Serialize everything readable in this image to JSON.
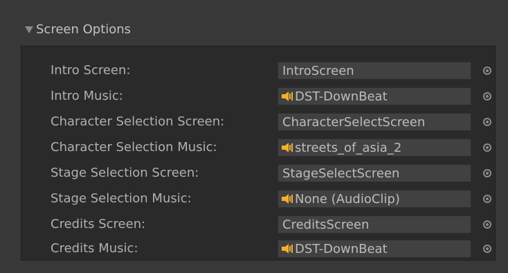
{
  "foldout": {
    "label": "Screen Options",
    "expanded": true
  },
  "rows": [
    {
      "label": "Intro Screen:",
      "value": "IntroScreen",
      "type": "string"
    },
    {
      "label": "Intro Music:",
      "value": "DST-DownBeat",
      "type": "audio",
      "icon": "audio-clip-icon"
    },
    {
      "label": "Character Selection Screen:",
      "value": "CharacterSelectScreen",
      "type": "string"
    },
    {
      "label": "Character Selection Music:",
      "value": "streets_of_asia_2",
      "type": "audio",
      "icon": "audio-clip-icon"
    },
    {
      "label": "Stage Selection Screen:",
      "value": "StageSelectScreen",
      "type": "string"
    },
    {
      "label": "Stage Selection Music:",
      "value": "None (AudioClip)",
      "type": "audio",
      "icon": "audio-clip-icon"
    },
    {
      "label": "Credits Screen:",
      "value": "CreditsScreen",
      "type": "string"
    },
    {
      "label": "Credits Music:",
      "value": "DST-DownBeat",
      "type": "audio",
      "icon": "audio-clip-icon"
    }
  ],
  "colors": {
    "background": "#383838",
    "panel": "#2a2a2a",
    "field": "#414141",
    "text": "#b0b0b0",
    "audio_icon": "#f0b030"
  }
}
